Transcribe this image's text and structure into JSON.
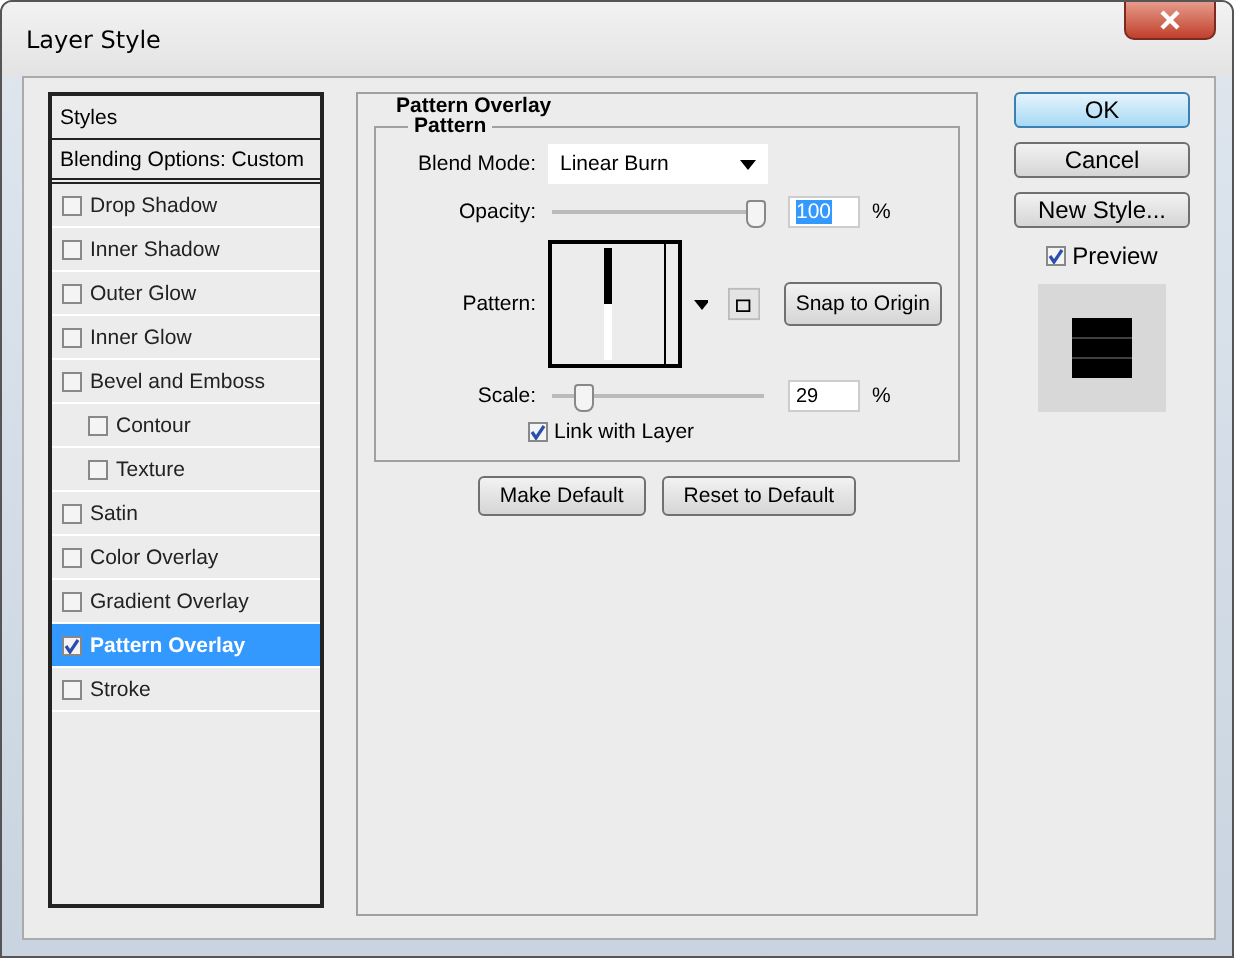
{
  "window": {
    "title": "Layer Style"
  },
  "styles_panel": {
    "header": "Styles",
    "blending_options": "Blending Options: Custom",
    "items": [
      {
        "label": "Drop Shadow",
        "checked": false,
        "selected": false
      },
      {
        "label": "Inner Shadow",
        "checked": false,
        "selected": false
      },
      {
        "label": "Outer Glow",
        "checked": false,
        "selected": false
      },
      {
        "label": "Inner Glow",
        "checked": false,
        "selected": false
      },
      {
        "label": "Bevel and Emboss",
        "checked": false,
        "selected": false,
        "children": [
          {
            "label": "Contour",
            "checked": false,
            "selected": false
          },
          {
            "label": "Texture",
            "checked": false,
            "selected": false
          }
        ]
      },
      {
        "label": "Satin",
        "checked": false,
        "selected": false
      },
      {
        "label": "Color Overlay",
        "checked": false,
        "selected": false
      },
      {
        "label": "Gradient Overlay",
        "checked": false,
        "selected": false
      },
      {
        "label": "Pattern Overlay",
        "checked": true,
        "selected": true
      },
      {
        "label": "Stroke",
        "checked": false,
        "selected": false
      }
    ]
  },
  "pattern_overlay": {
    "title": "Pattern Overlay",
    "group_title": "Pattern",
    "blend_mode": {
      "label": "Blend Mode:",
      "value": "Linear Burn"
    },
    "opacity": {
      "label": "Opacity:",
      "level": 1.0,
      "value": "100",
      "unit": "%"
    },
    "pattern": {
      "label": "Pattern:",
      "snap_button": "Snap to Origin"
    },
    "scale": {
      "label": "Scale:",
      "level": 0.12,
      "value": "29",
      "unit": "%"
    },
    "link_with_layer": {
      "label": "Link with Layer",
      "checked": true
    },
    "buttons": [
      "Make Default",
      "Reset to Default"
    ]
  },
  "actions": {
    "buttons": [
      {
        "label": "OK",
        "default": true
      },
      {
        "label": "Cancel",
        "default": false
      },
      {
        "label": "New Style...",
        "default": false
      }
    ],
    "preview": {
      "label": "Preview",
      "checked": true
    }
  }
}
